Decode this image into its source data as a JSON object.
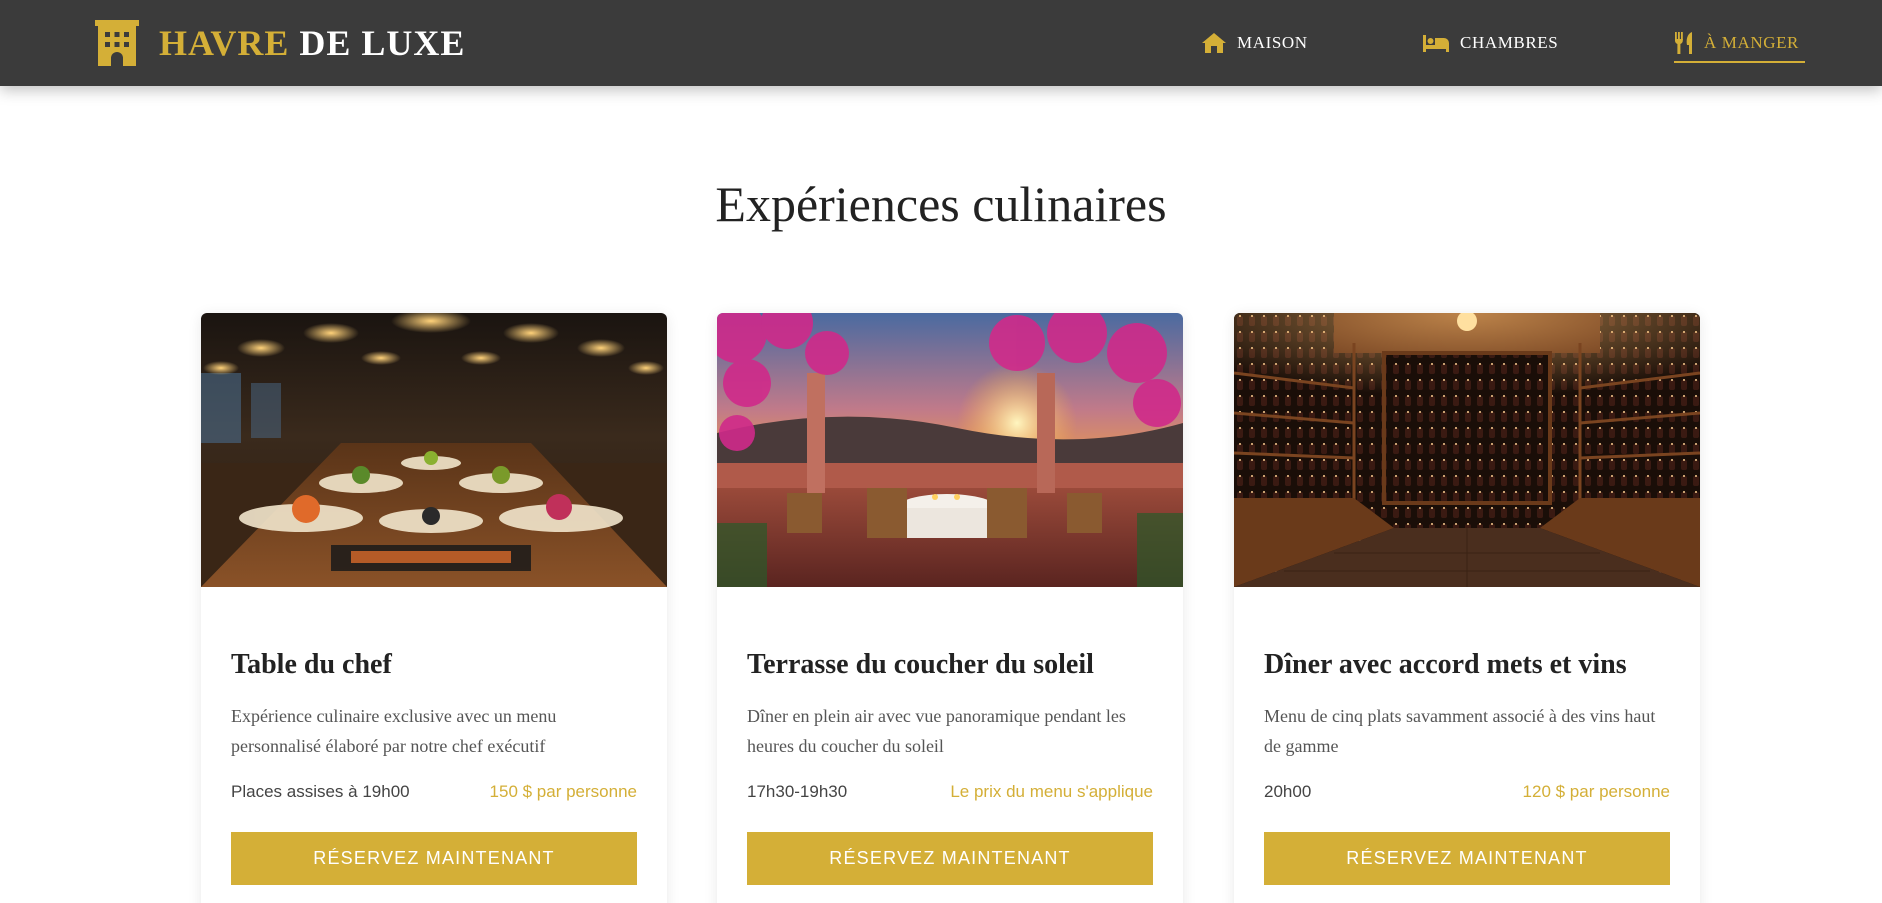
{
  "brand": {
    "name_part1": "HAVRE",
    "name_part2": "DE LUXE",
    "icon": "hotel-building-icon"
  },
  "nav": {
    "items": [
      {
        "label": "MAISON",
        "icon": "home-icon",
        "active": false
      },
      {
        "label": "CHAMBRES",
        "icon": "bed-icon",
        "active": false
      },
      {
        "label": "À MANGER",
        "icon": "utensils-icon",
        "active": true
      }
    ]
  },
  "colors": {
    "accent": "#d4af37",
    "header_bg": "#3b3b3b",
    "text_dark": "#222222",
    "text_muted": "#555555"
  },
  "page": {
    "title": "Expériences culinaires"
  },
  "cards": [
    {
      "title": "Table du chef",
      "description": "Expérience culinaire exclusive avec un menu personnalisé élaboré par notre chef exécutif",
      "time": "Places assises à 19h00",
      "price": "150 $ par personne",
      "button": "RÉSERVEZ MAINTENANT",
      "image": "chef-table-photo"
    },
    {
      "title": "Terrasse du coucher du soleil",
      "description": "Dîner en plein air avec vue panoramique pendant les heures du coucher du soleil",
      "time": "17h30-19h30",
      "price": "Le prix du menu s'applique",
      "button": "RÉSERVEZ MAINTENANT",
      "image": "sunset-terrace-photo"
    },
    {
      "title": "Dîner avec accord mets et vins",
      "description": "Menu de cinq plats savamment associé à des vins haut de gamme",
      "time": "20h00",
      "price": "120 $ par personne",
      "button": "RÉSERVEZ MAINTENANT",
      "image": "wine-cellar-photo"
    }
  ]
}
